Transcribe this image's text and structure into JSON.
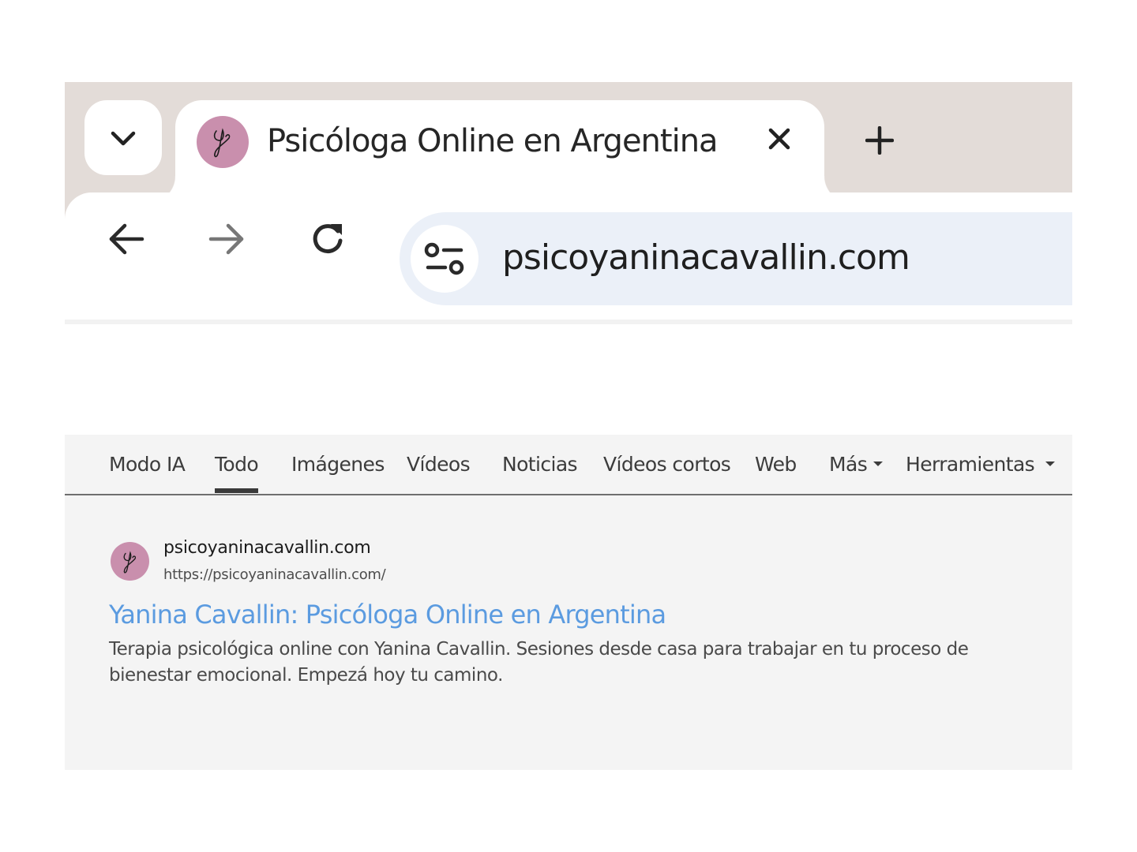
{
  "tab": {
    "title": "Psicóloga Online en Argentina",
    "favicon": "yc-signature-icon"
  },
  "toolbar": {
    "url": "psicoyaninacavallin.com"
  },
  "filters": [
    {
      "label": "Modo IA",
      "active": false
    },
    {
      "label": "Todo",
      "active": true
    },
    {
      "label": "Imágenes",
      "active": false
    },
    {
      "label": "Vídeos",
      "active": false
    },
    {
      "label": "Noticias",
      "active": false
    },
    {
      "label": "Vídeos cortos",
      "active": false
    },
    {
      "label": "Web",
      "active": false
    },
    {
      "label": "Más",
      "active": false
    },
    {
      "label": "Herramientas",
      "active": false
    }
  ],
  "result": {
    "site_name": "psicoyaninacavallin.com",
    "url": "https://psicoyaninacavallin.com/",
    "title": "Yanina Cavallin: Psicóloga Online en Argentina",
    "snippet": "Terapia psicológica online con Yanina Cavallin. Sesiones desde casa para trabajar en tu proceso de bienestar emocional. Empezá hoy tu camino."
  },
  "colors": {
    "chrome_bg": "#e3dcd8",
    "omnibox_bg": "#ebf0f8",
    "favicon_bg": "#c98fad",
    "result_title": "#5b9be0",
    "results_bg": "#f4f4f4"
  }
}
